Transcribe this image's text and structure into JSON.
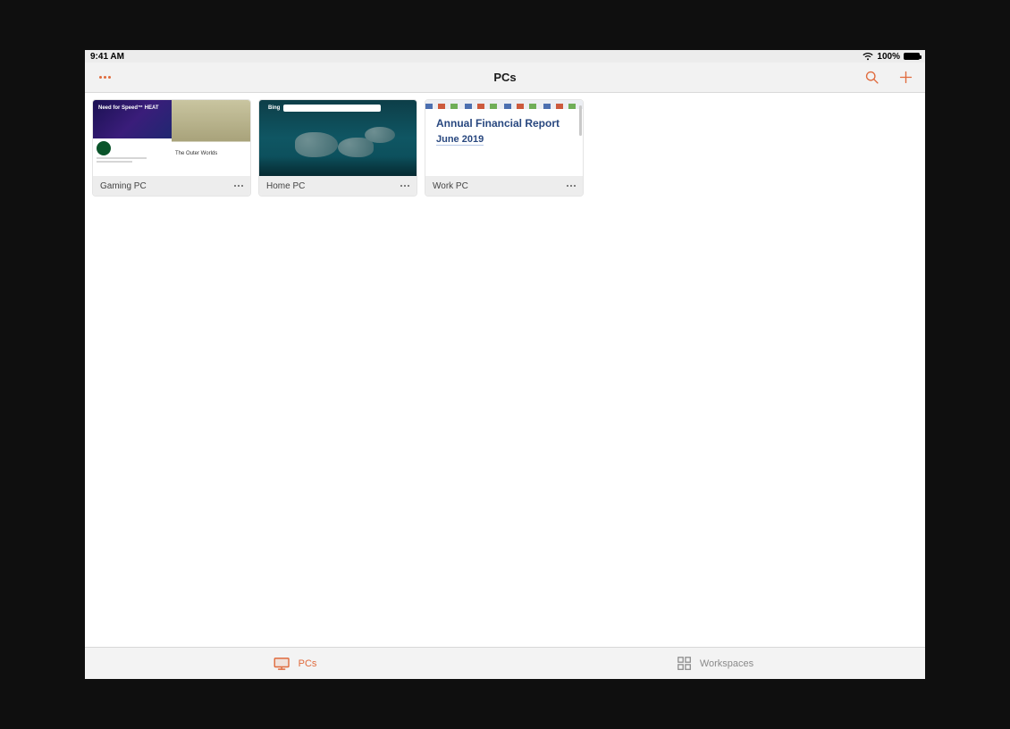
{
  "statusbar": {
    "time": "9:41 AM",
    "battery_pct": "100%"
  },
  "navbar": {
    "title": "PCs"
  },
  "pcs": [
    {
      "name": "Gaming PC",
      "thumb_kind": "gaming",
      "thumb_text_1": "Need for Speed™ HEAT",
      "thumb_text_2": "The Outer Worlds"
    },
    {
      "name": "Home PC",
      "thumb_kind": "home",
      "thumb_logo": "Bing"
    },
    {
      "name": "Work PC",
      "thumb_kind": "work",
      "doc_title": "Annual Financial Report",
      "doc_sub": "June 2019"
    }
  ],
  "tabs": {
    "pcs_label": "PCs",
    "workspaces_label": "Workspaces"
  },
  "colors": {
    "accent": "#e06a3c"
  }
}
